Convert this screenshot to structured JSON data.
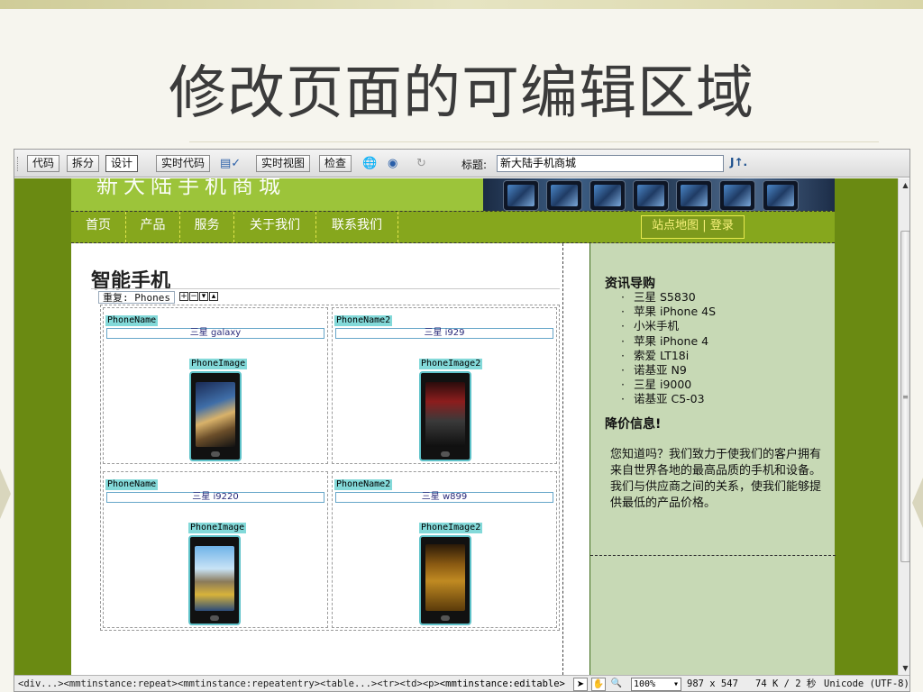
{
  "slide": {
    "title": "修改页面的可编辑区域"
  },
  "toolbar": {
    "code": "代码",
    "split": "拆分",
    "design": "设计",
    "live_code": "实时代码",
    "live_view": "实时视图",
    "inspect": "检查",
    "title_label": "标题:",
    "title_value": "新大陆手机商城",
    "sort_icon": "J↑."
  },
  "site": {
    "logo": "新大陆手机商城",
    "nav": [
      "首页",
      "产品",
      "服务",
      "关于我们",
      "联系我们"
    ],
    "nav_right": "站点地图 | 登录"
  },
  "main": {
    "title": "智能手机",
    "repeat_label": "重复: Phones",
    "repeat_buttons": [
      "+",
      "−",
      "▾",
      "▴"
    ],
    "cells": [
      {
        "name_tag": "PhoneName",
        "name": "三星 galaxy",
        "image_tag": "PhoneImage"
      },
      {
        "name_tag": "PhoneName2",
        "name": "三星 i929",
        "image_tag": "PhoneImage2"
      },
      {
        "name_tag": "PhoneName",
        "name": "三星 i9220",
        "image_tag": "PhoneImage"
      },
      {
        "name_tag": "PhoneName2",
        "name": "三星 w899",
        "image_tag": "PhoneImage2"
      }
    ]
  },
  "side": {
    "guide_title": "资讯导购",
    "guide_items": [
      "三星 S5830",
      "苹果 iPhone 4S",
      "小米手机",
      "苹果 iPhone 4",
      "索爱 LT18i",
      "诺基亚 N9",
      "三星 i9000",
      "诺基亚 C5-03"
    ],
    "price_title": "降价信息!",
    "paragraph": "您知道吗？我们致力于使我们的客户拥有来自世界各地的最高品质的手机和设备。我们与供应商之间的关系，使我们能够提供最低的产品价格。"
  },
  "status": {
    "crumbs": "<div...><mmtinstance:repeat><mmtinstance:repeatentry><table...><tr><td><p>",
    "crumb_current": "<mmtinstance:editable>",
    "zoom": "100%",
    "size": "987 x 547",
    "filesize": "74 K / 2 秒",
    "encoding": "Unicode (UTF-8)"
  },
  "colors": {
    "canvas_bg": "#6a8a12",
    "header_bg": "#9cc43a",
    "nav_bg": "#86a71d",
    "sidebar_bg": "#c7d9b5",
    "template_tag": "#83d9d9"
  }
}
